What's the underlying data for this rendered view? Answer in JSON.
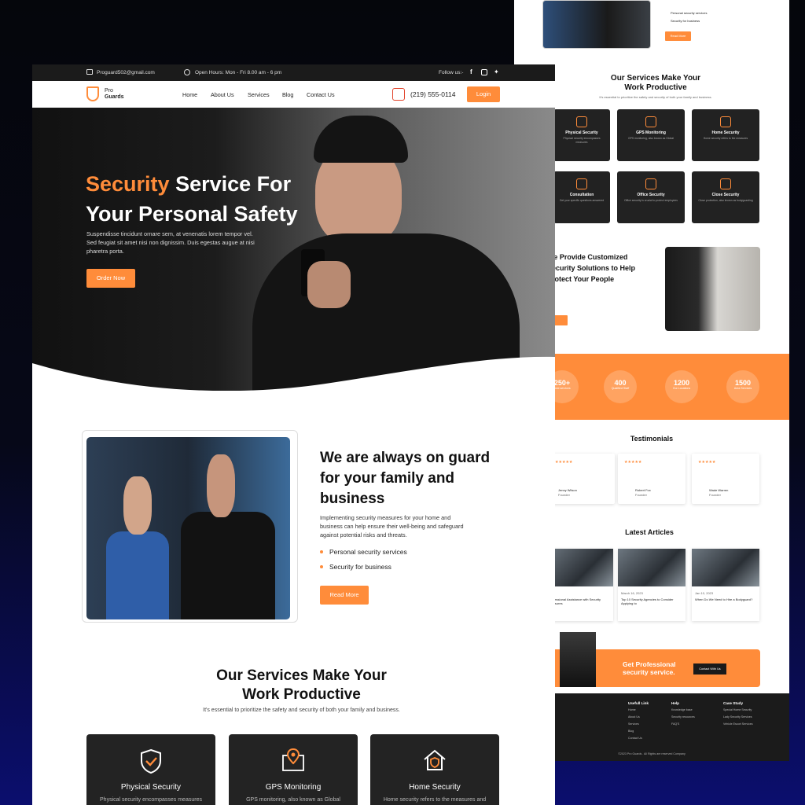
{
  "colors": {
    "accent": "#ff8c3a",
    "dark": "#1b1b1b"
  },
  "topbar": {
    "email": "Proguard502@gmail.com",
    "hours": "Open Hours: Mon - Fri 8.00 am - 6 pm",
    "follow": "Follow us:-",
    "socials": [
      "facebook-icon",
      "instagram-icon",
      "twitter-icon"
    ]
  },
  "brand": {
    "line1": "Pro",
    "line2": "Guards"
  },
  "nav": {
    "items": [
      "Home",
      "About Us",
      "Services",
      "Blog",
      "Contact Us"
    ],
    "phone": "(219) 555-0114",
    "login": "Login"
  },
  "hero": {
    "title_accent": "Security",
    "title_rest": "Service For",
    "title_line2": "Your Personal Safety",
    "text": "Suspendisse tincidunt ornare sem, at venenatis lorem tempor vel. Sed feugiat sit amet nisi non dignissim. Duis egestas augue at nisi pharetra porta.",
    "cta": "Order Now"
  },
  "about": {
    "title": "We are always on guard for your family and business",
    "text": "Implementing security measures for your home and business can help ensure their well-being and safeguard against potential risks and threats.",
    "bullets": [
      "Personal security services",
      "Security for business"
    ],
    "cta": "Read More"
  },
  "services": {
    "title_line1": "Our Services Make Your",
    "title_line2": "Work Productive",
    "subtitle": "It's essential to prioritize the safety and security of both your family and business.",
    "cards": [
      {
        "title": "Physical Security",
        "desc": "Physical security encompasses measures",
        "icon": "shield-check-icon"
      },
      {
        "title": "GPS Monitoring",
        "desc": "GPS monitoring, also known as Global",
        "icon": "map-pin-icon"
      },
      {
        "title": "Home Security",
        "desc": "Home security refers to the measures and",
        "icon": "home-shield-icon"
      }
    ]
  },
  "back": {
    "bullets": [
      "Personal security services",
      "Security for business"
    ],
    "read_more": "Read More",
    "services_title_line1": "Our Services Make Your",
    "services_title_line2": "Work Productive",
    "services_subtitle": "It's essential to prioritize the safety and security of both your family and business.",
    "cards": [
      "Physical Security",
      "GPS Monitoring",
      "Home Security",
      "Consultation",
      "Office Security",
      "Close Security"
    ],
    "solutions_title": "We Provide Customized Security Solutions to Help Protect Your People",
    "stats": [
      {
        "n": "250+",
        "l": "Best services"
      },
      {
        "n": "400",
        "l": "Qualified Staff"
      },
      {
        "n": "1200",
        "l": "Our Locations"
      },
      {
        "n": "1500",
        "l": "Area Services"
      }
    ],
    "testimonials_title": "Testimonials",
    "testimonials": [
      {
        "name": "Jenny Wilson",
        "role": "Founder"
      },
      {
        "name": "Robert Fox",
        "role": "Founder"
      },
      {
        "name": "Wade Warren",
        "role": "Founder"
      }
    ],
    "articles_title": "Latest Articles",
    "articles": [
      {
        "date": "",
        "title": "Professional Assistance with Security Measures"
      },
      {
        "date": "March 16, 2023",
        "title": "Top 10 Security Agencies to Consider Applying to"
      },
      {
        "date": "Jan 10, 2023",
        "title": "When Do We Need to Hire a Bodyguard?"
      }
    ],
    "cta_title": "Get Professional security service.",
    "cta_button": "Contact With Us",
    "footer_cols": [
      {
        "h": "Usefull Link",
        "items": [
          "Home",
          "About Us",
          "Services",
          "Blog",
          "Contact Us"
        ]
      },
      {
        "h": "Help",
        "items": [
          "Knowledge base",
          "Security resources",
          "FAQ'S"
        ]
      },
      {
        "h": "Case Study",
        "items": [
          "Special Home Security",
          "Lady Security Services",
          "Vehicle Escort Services"
        ]
      }
    ],
    "copyright": "©2023 Pro Guards . All Rights are reserved Company"
  }
}
